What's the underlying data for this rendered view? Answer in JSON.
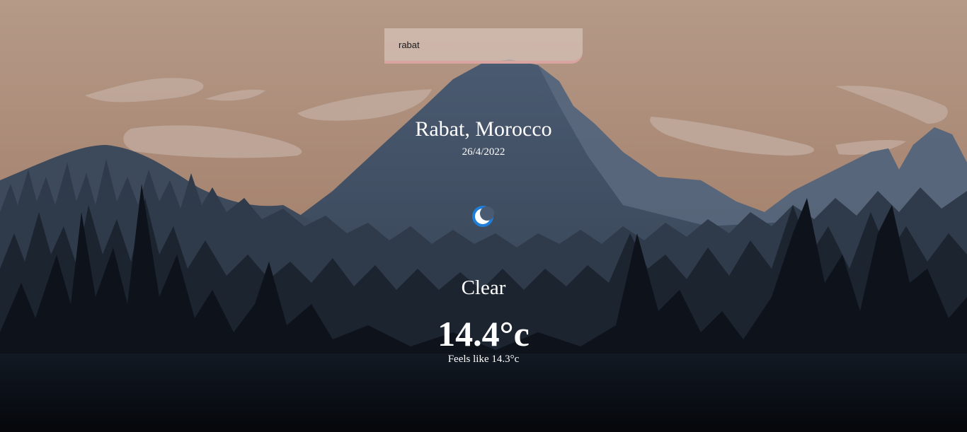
{
  "search": {
    "value": "rabat",
    "placeholder": ""
  },
  "location": {
    "city_country": "Rabat, Morocco",
    "date": "26/4/2022"
  },
  "weather": {
    "icon": "moon-icon",
    "condition": "Clear",
    "temperature": "14.4°c",
    "feels_like": "Feels like 14.3°c"
  },
  "colors": {
    "sky_top": "#b59a88",
    "sky_bottom": "#9a7560",
    "mountain": "#4a5a70",
    "forest_dark": "#0b0f16",
    "icon_blue": "#1f7fd8"
  }
}
